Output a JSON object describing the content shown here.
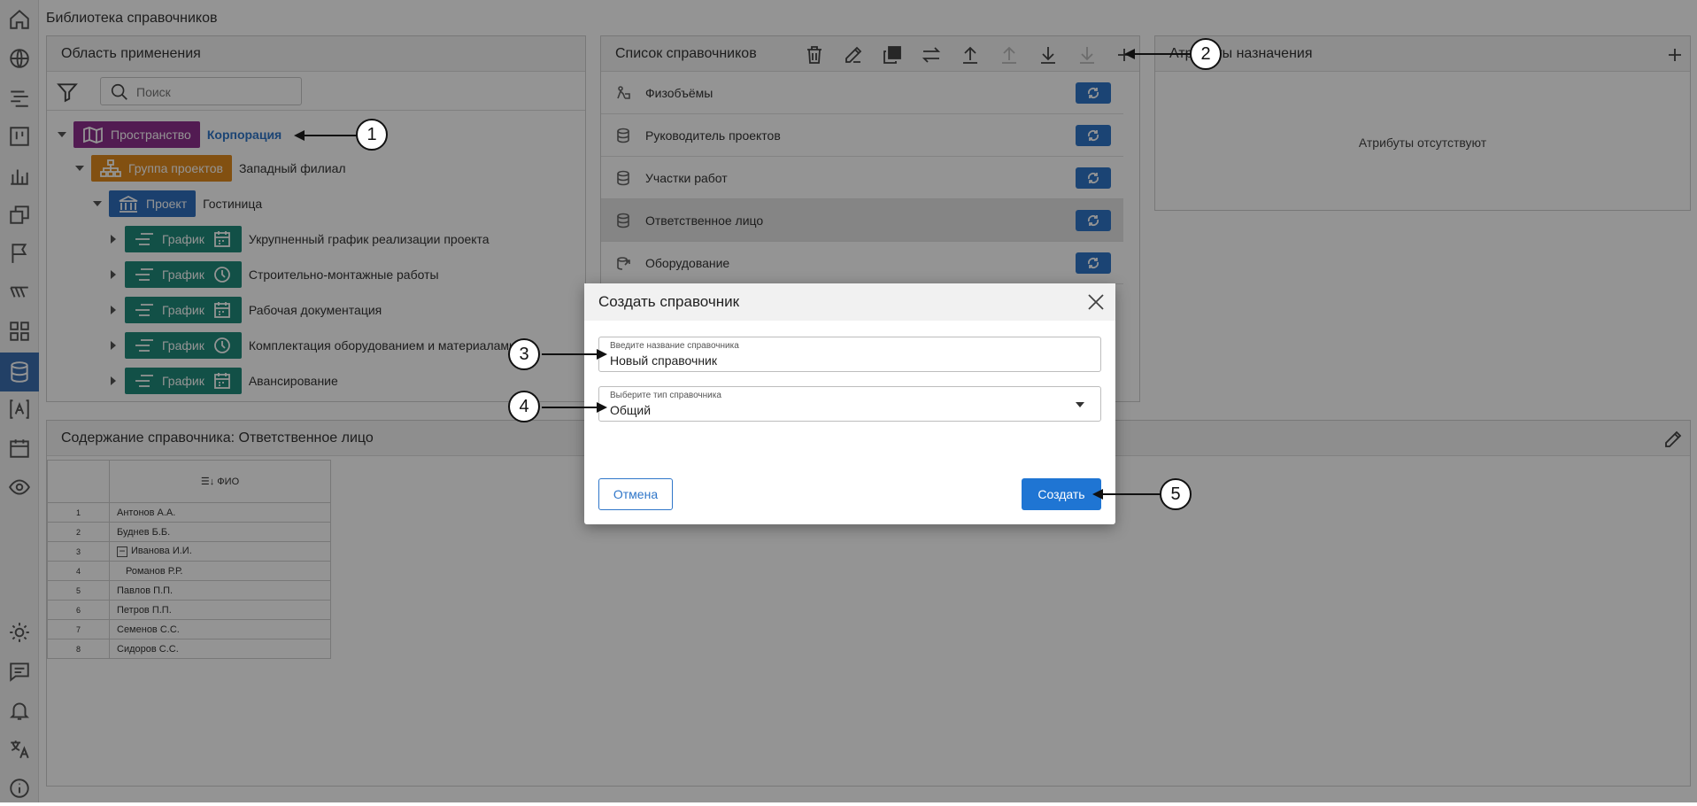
{
  "page_title": "Библиотека справочников",
  "sidebar": {
    "icons": [
      "home-icon",
      "globe-icon",
      "list-icon",
      "kanban-icon",
      "chart-icon",
      "windows-icon",
      "flag-icon",
      "lines-icon",
      "grid-icon",
      "database-icon",
      "text-a-icon",
      "calendar-icon",
      "eye-icon",
      "sun-icon",
      "chat-icon",
      "bell-icon",
      "translate-icon",
      "info-icon"
    ],
    "active": "database-icon"
  },
  "scope_panel": {
    "title": "Область применения",
    "search_placeholder": "Поиск",
    "tree": [
      {
        "tag": "Пространство",
        "label": "Корпорация",
        "color": "#8e2f8e"
      },
      {
        "tag": "Группа проектов",
        "label": "Западный филиал",
        "color": "#e08a1e"
      },
      {
        "tag": "Проект",
        "label": "Гостиница",
        "color": "#2f6fbe"
      },
      {
        "tag": "График",
        "label": "Укрупненный график реализации проекта",
        "color": "#1f8a7a",
        "icon": "calendar-icon"
      },
      {
        "tag": "График",
        "label": "Строительно-монтажные работы",
        "color": "#1f8a7a",
        "icon": "clock-icon"
      },
      {
        "tag": "График",
        "label": "Рабочая документация",
        "color": "#1f8a7a",
        "icon": "calendar-icon"
      },
      {
        "tag": "График",
        "label": "Комплектация оборудованием и материалами",
        "color": "#1f8a7a",
        "icon": "clock-icon"
      },
      {
        "tag": "График",
        "label": "Авансирование",
        "color": "#1f8a7a",
        "icon": "calendar-icon"
      }
    ]
  },
  "list_panel": {
    "title": "Список справочников",
    "items": [
      "Физобъёмы",
      "Руководитель проектов",
      "Участки работ",
      "Ответственное лицо",
      "Оборудование"
    ]
  },
  "attr_panel": {
    "title": "Атрибуты назначения",
    "empty_text": "Атрибуты отсутствуют"
  },
  "content_panel": {
    "title": "Содержание справочника: Ответственное лицо",
    "column": "ФИО",
    "rows": [
      {
        "n": "1",
        "name": "Антонов А.А."
      },
      {
        "n": "2",
        "name": "Буднев Б.Б."
      },
      {
        "n": "3",
        "name": "Иванова И.И."
      },
      {
        "n": "4",
        "name": "Романов Р.Р."
      },
      {
        "n": "5",
        "name": "Павлов П.П."
      },
      {
        "n": "6",
        "name": "Петров П.П."
      },
      {
        "n": "7",
        "name": "Семенов С.С."
      },
      {
        "n": "8",
        "name": "Сидоров С.С."
      }
    ]
  },
  "dialog": {
    "title": "Создать справочник",
    "name_label": "Введите название справочника",
    "name_value": "Новый справочник",
    "type_label": "Выберите тип справочника",
    "type_value": "Общий",
    "cancel": "Отмена",
    "create": "Создать"
  },
  "callouts": [
    "1",
    "2",
    "3",
    "4",
    "5"
  ],
  "colors": {
    "accent": "#1f75d3",
    "sync": "#2f76c9",
    "active_sidebar": "#3b6fb0"
  }
}
